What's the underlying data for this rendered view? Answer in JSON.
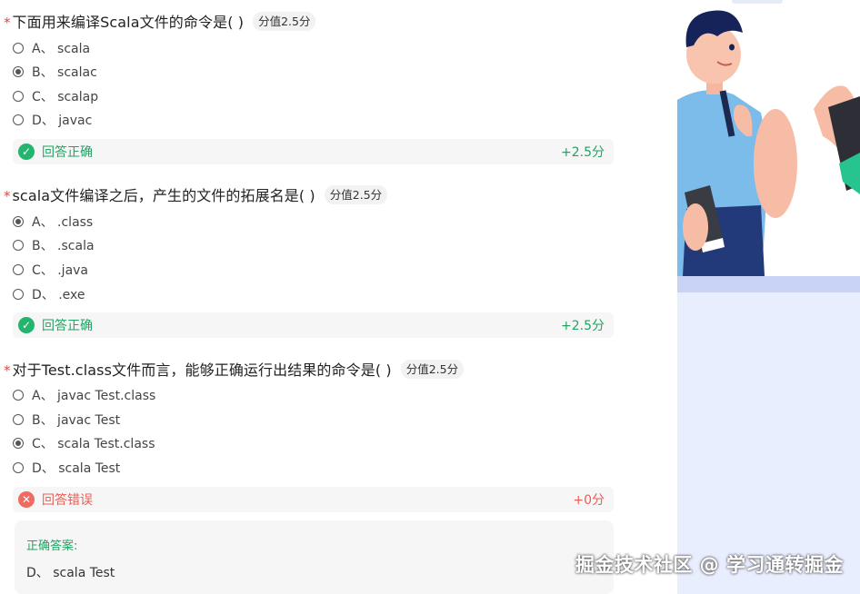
{
  "questions": [
    {
      "title": "下面用来编译Scala文件的命令是( )",
      "score_label": "分值2.5分",
      "options": [
        {
          "label": "A、 scala",
          "selected": false
        },
        {
          "label": "B、 scalac",
          "selected": true
        },
        {
          "label": "C、 scalap",
          "selected": false
        },
        {
          "label": "D、 javac",
          "selected": false
        }
      ],
      "result": {
        "status": "correct",
        "label": "回答正确",
        "score": "+2.5分"
      }
    },
    {
      "title": "scala文件编译之后，产生的文件的拓展名是( )",
      "score_label": "分值2.5分",
      "options": [
        {
          "label": "A、 .class",
          "selected": true
        },
        {
          "label": "B、 .scala",
          "selected": false
        },
        {
          "label": "C、 .java",
          "selected": false
        },
        {
          "label": "D、 .exe",
          "selected": false
        }
      ],
      "result": {
        "status": "correct",
        "label": "回答正确",
        "score": "+2.5分"
      }
    },
    {
      "title": "对于Test.class文件而言，能够正确运行出结果的命令是( )",
      "score_label": "分值2.5分",
      "options": [
        {
          "label": "A、 javac Test.class",
          "selected": false
        },
        {
          "label": "B、 javac Test",
          "selected": false
        },
        {
          "label": "C、 scala Test.class",
          "selected": true
        },
        {
          "label": "D、 scala Test",
          "selected": false
        }
      ],
      "result": {
        "status": "wrong",
        "label": "回答错误",
        "score": "+0分"
      }
    }
  ],
  "correct_answer": {
    "label": "正确答案:",
    "text": "D、 scala Test"
  },
  "watermark": "掘金技术社区 @ 学习通转掘金",
  "icons": {
    "correct": "check-circle-icon",
    "wrong": "x-circle-icon"
  },
  "colors": {
    "correct": "#23b46e",
    "wrong": "#f06a5f",
    "required": "#e8473f"
  }
}
